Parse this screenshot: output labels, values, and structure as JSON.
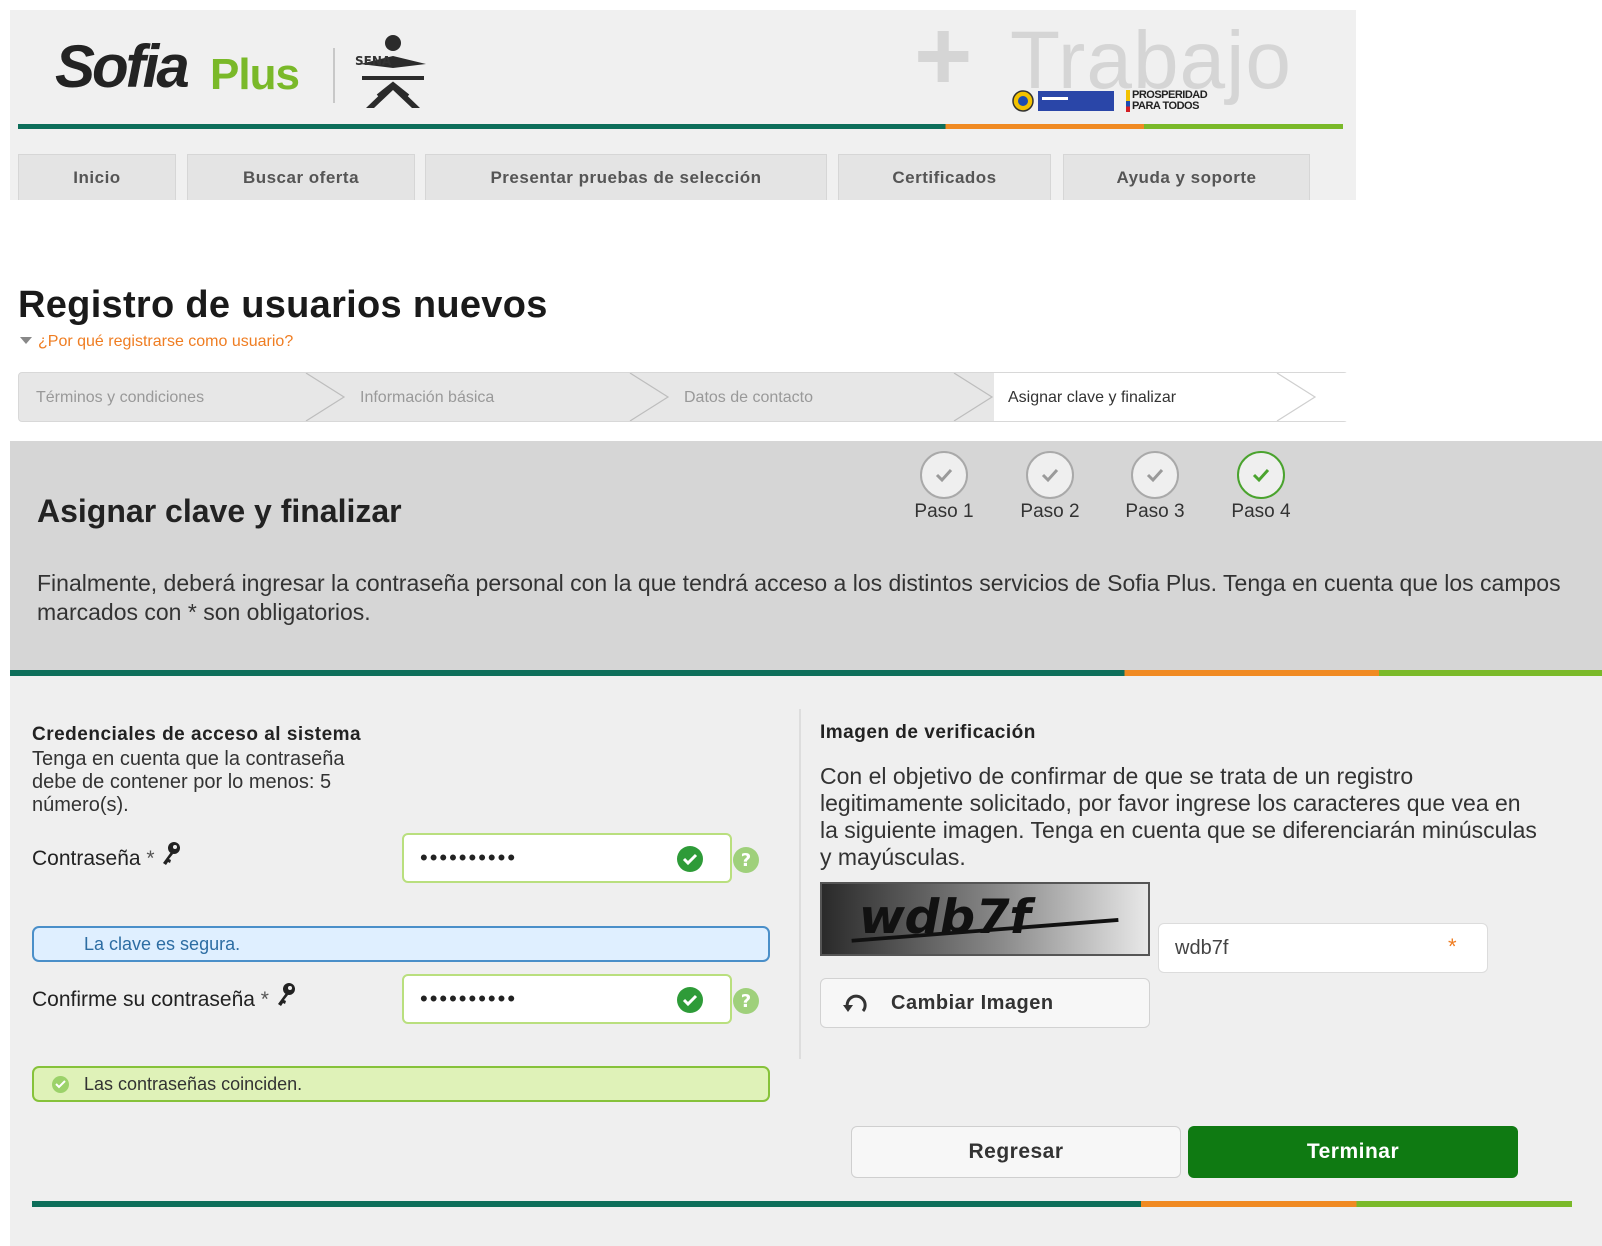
{
  "header": {
    "logo_sofia": "Sofia",
    "logo_plus": "Plus",
    "logo_sena": "SENA",
    "trabajo_plus": "+",
    "trabajo": "Trabajo",
    "prosperidad": "PROSPERIDAD PARA TODOS"
  },
  "nav": {
    "tabs": [
      {
        "label": "Inicio"
      },
      {
        "label": "Buscar oferta"
      },
      {
        "label": "Presentar pruebas de selección"
      },
      {
        "label": "Certificados"
      },
      {
        "label": "Ayuda y soporte"
      }
    ]
  },
  "page": {
    "title": "Registro de usuarios nuevos",
    "why_link": "¿Por qué registrarse como usuario?"
  },
  "steps": [
    {
      "label": "Términos y condiciones",
      "active": false
    },
    {
      "label": "Información básica",
      "active": false
    },
    {
      "label": "Datos de contacto",
      "active": false
    },
    {
      "label": "Asignar clave y finalizar",
      "active": true
    }
  ],
  "section": {
    "title": "Asignar clave y finalizar",
    "pasos": [
      {
        "label": "Paso 1",
        "done": true
      },
      {
        "label": "Paso 2",
        "done": true
      },
      {
        "label": "Paso 3",
        "done": true
      },
      {
        "label": "Paso 4",
        "current": true
      }
    ],
    "instructions": "Finalmente, deberá ingresar la contraseña personal con la que tendrá acceso a los distintos servicios de Sofia Plus. Tenga en cuenta que los campos marcados con * son obligatorios."
  },
  "credentials": {
    "title": "Credenciales de acceso al sistema",
    "note": "Tenga en cuenta que la contraseña debe de contener por lo menos: 5 número(s).",
    "password_label": "Contraseña",
    "password_value": "••••••••••",
    "confirm_label": "Confirme su contraseña",
    "confirm_value": "••••••••••",
    "required_mark": "*",
    "help_mark": "?",
    "msg_secure": "La clave es segura.",
    "msg_match": "Las contraseñas coinciden."
  },
  "verification": {
    "title": "Imagen de verificación",
    "text": "Con el objetivo de confirmar de que se trata de un registro legitimamente solicitado, por favor ingrese los caracteres que vea en la siguiente imagen. Tenga en cuenta que se diferenciarán minúsculas y mayúsculas.",
    "captcha_text": "wdb7f",
    "input_value": "wdb7f",
    "required_mark": "*",
    "change_button": "Cambiar Imagen"
  },
  "actions": {
    "back": "Regresar",
    "finish": "Terminar"
  },
  "colors": {
    "green_dark": "#0f7a12",
    "teal": "#0d6e5a",
    "orange": "#ef7d22",
    "lime": "#7ab929"
  }
}
